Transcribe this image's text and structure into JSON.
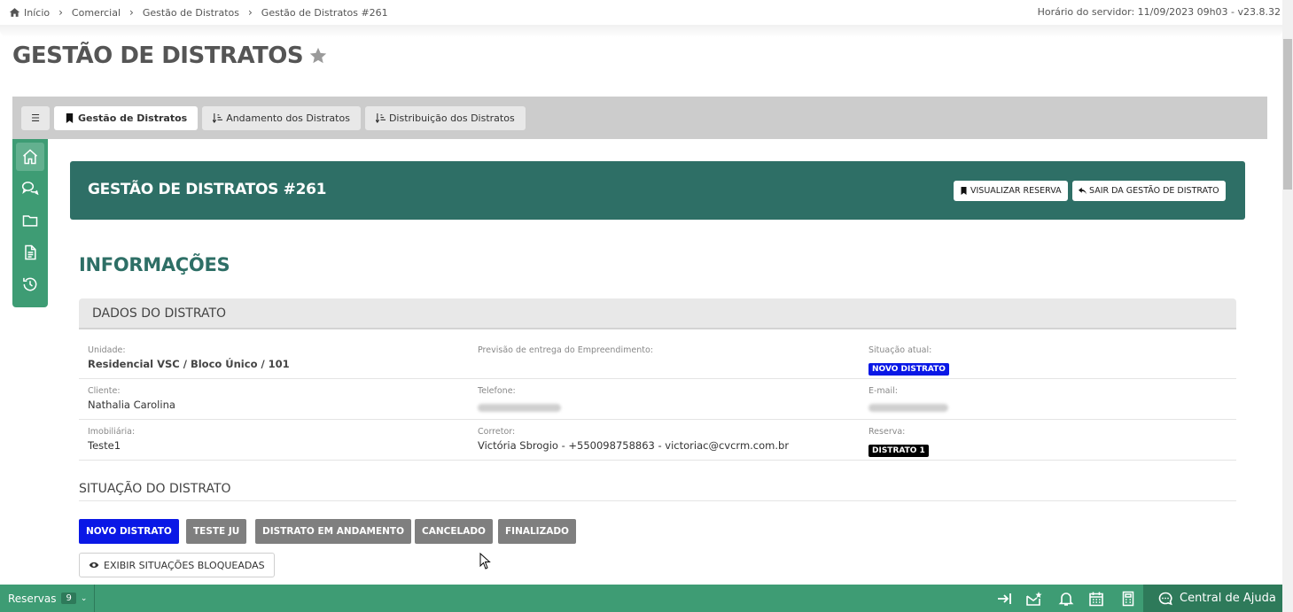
{
  "breadcrumb": {
    "items": [
      "Início",
      "Comercial",
      "Gestão de Distratos",
      "Gestão de Distratos #261"
    ],
    "server_time": "Horário do servidor: 11/09/2023 09h03 - v23.8.32"
  },
  "page_title": "GESTÃO DE DISTRATOS",
  "tabs": [
    {
      "label": "Gestão de Distratos"
    },
    {
      "label": "Andamento dos Distratos"
    },
    {
      "label": "Distribuição dos Distratos"
    }
  ],
  "header": {
    "title": "GESTÃO DE DISTRATOS #261",
    "view_button": "VISUALIZAR RESERVA",
    "exit_button": "SAIR DA GESTÃO DE DISTRATO"
  },
  "section_title": "INFORMAÇÕES",
  "panel_title": "DADOS DO DISTRATO",
  "fields": {
    "unidade_label": "Unidade:",
    "unidade_value": "Residencial VSC / Bloco Único / 101",
    "previsao_label": "Previsão de entrega do Empreendimento:",
    "situacao_label": "Situação atual:",
    "situacao_value": "NOVO DISTRATO",
    "cliente_label": "Cliente:",
    "cliente_value": "Nathalia Carolina",
    "telefone_label": "Telefone:",
    "email_label": "E-mail:",
    "imobiliaria_label": "Imobiliária:",
    "imobiliaria_value": "Teste1",
    "corretor_label": "Corretor:",
    "corretor_value": "Victória Sbrogio - +550098758863 - victoriac@cvcrm.com.br",
    "reserva_label": "Reserva:",
    "reserva_value": "DISTRATO 1"
  },
  "status_section": {
    "title": "SITUAÇÃO DO DISTRATO",
    "buttons": [
      "NOVO DISTRATO",
      "TESTE JU",
      "DISTRATO EM ANDAMENTO",
      "CANCELADO",
      "FINALIZADO"
    ],
    "show_blocked": "EXIBIR SITUAÇÕES BLOQUEADAS"
  },
  "bottom_bar": {
    "reservas_label": "Reservas",
    "reservas_count": "9",
    "help_label": "Central de Ajuda"
  },
  "colors": {
    "accent_green": "#3e9c74",
    "header_teal": "#2e6f66",
    "status_blue": "#0a18e6",
    "status_gray": "#7f7f7f"
  }
}
